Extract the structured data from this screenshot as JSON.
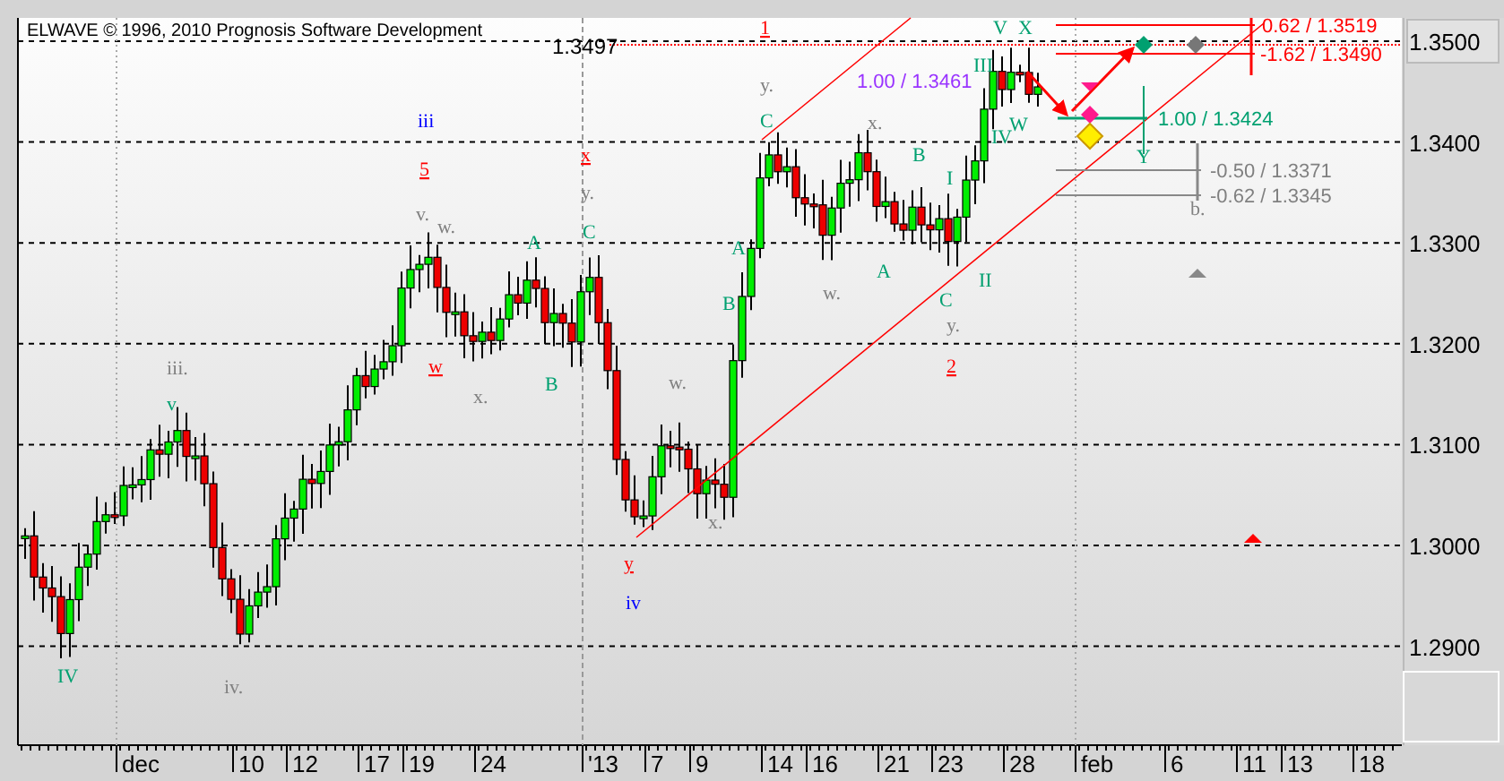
{
  "title": "ELWAVE © 1996, 2010 Prognosis Software Development",
  "price_marker": "1.3497",
  "price_axis": [
    "1.3500",
    "1.3400",
    "1.3300",
    "1.3200",
    "1.3100",
    "1.3000",
    "1.2900"
  ],
  "date_axis": [
    "dec",
    "10",
    "12",
    "17",
    "19",
    "24",
    "'13",
    "7",
    "9",
    "14",
    "16",
    "21",
    "23",
    "28",
    "feb",
    "6",
    "11",
    "13",
    "18"
  ],
  "wave_labels": [
    {
      "text": "iii",
      "color": "#0000ff",
      "underlined": false
    },
    {
      "text": "5",
      "color": "#ff0000",
      "underlined": true
    },
    {
      "text": "v.",
      "color": "#808080",
      "underlined": false
    },
    {
      "text": "w.",
      "color": "#808080",
      "underlined": false
    },
    {
      "text": "A",
      "color": "#00a070",
      "underlined": false
    },
    {
      "text": "x",
      "color": "#ff0000",
      "underlined": true
    },
    {
      "text": "y.",
      "color": "#808080",
      "underlined": false
    },
    {
      "text": "C",
      "color": "#00a070",
      "underlined": false
    },
    {
      "text": "w",
      "color": "#ff0000",
      "underlined": true
    },
    {
      "text": "x.",
      "color": "#808080",
      "underlined": false
    },
    {
      "text": "B",
      "color": "#00a070",
      "underlined": false
    },
    {
      "text": "iii.",
      "color": "#808080",
      "underlined": false
    },
    {
      "text": "v",
      "color": "#00a070",
      "underlined": false
    },
    {
      "text": "IV",
      "color": "#00a070",
      "underlined": false
    },
    {
      "text": "iv.",
      "color": "#808080",
      "underlined": false
    },
    {
      "text": "w.",
      "color": "#808080",
      "underlined": false
    },
    {
      "text": "x.",
      "color": "#808080",
      "underlined": false
    },
    {
      "text": "y",
      "color": "#ff0000",
      "underlined": true
    },
    {
      "text": "iv",
      "color": "#0000ff",
      "underlined": false
    },
    {
      "text": "A",
      "color": "#00a070",
      "underlined": false
    },
    {
      "text": "B",
      "color": "#00a070",
      "underlined": false
    },
    {
      "text": "1",
      "color": "#ff0000",
      "underlined": true
    },
    {
      "text": "y.",
      "color": "#808080",
      "underlined": false
    },
    {
      "text": "C",
      "color": "#00a070",
      "underlined": false
    },
    {
      "text": "x.",
      "color": "#808080",
      "underlined": false
    },
    {
      "text": "B",
      "color": "#00a070",
      "underlined": false
    },
    {
      "text": "w.",
      "color": "#808080",
      "underlined": false
    },
    {
      "text": "A",
      "color": "#00a070",
      "underlined": false
    },
    {
      "text": "I",
      "color": "#00a070",
      "underlined": false
    },
    {
      "text": "II",
      "color": "#00a070",
      "underlined": false
    },
    {
      "text": "C",
      "color": "#00a070",
      "underlined": false
    },
    {
      "text": "y.",
      "color": "#808080",
      "underlined": false
    },
    {
      "text": "2",
      "color": "#ff0000",
      "underlined": true
    },
    {
      "text": "V",
      "color": "#00a070",
      "underlined": false
    },
    {
      "text": "X",
      "color": "#00a070",
      "underlined": false
    },
    {
      "text": "III",
      "color": "#00a070",
      "underlined": false
    },
    {
      "text": "W",
      "color": "#00a070",
      "underlined": false
    },
    {
      "text": "IV",
      "color": "#00a070",
      "underlined": false
    },
    {
      "text": "Y",
      "color": "#00a070",
      "underlined": false
    },
    {
      "text": "b.",
      "color": "#808080",
      "underlined": false
    }
  ],
  "targets": [
    {
      "text": "0.62 / 1.3519",
      "color": "#ff0000"
    },
    {
      "text": "-1.62 / 1.3490",
      "color": "#ff0000"
    },
    {
      "text": "1.00 / 1.3424",
      "color": "#00a070"
    },
    {
      "text": "-0.50 / 1.3371",
      "color": "#808080"
    },
    {
      "text": "-0.62 / 1.3345",
      "color": "#808080"
    },
    {
      "text": "1.00 / 1.3461",
      "color": "#9933ff"
    }
  ]
}
